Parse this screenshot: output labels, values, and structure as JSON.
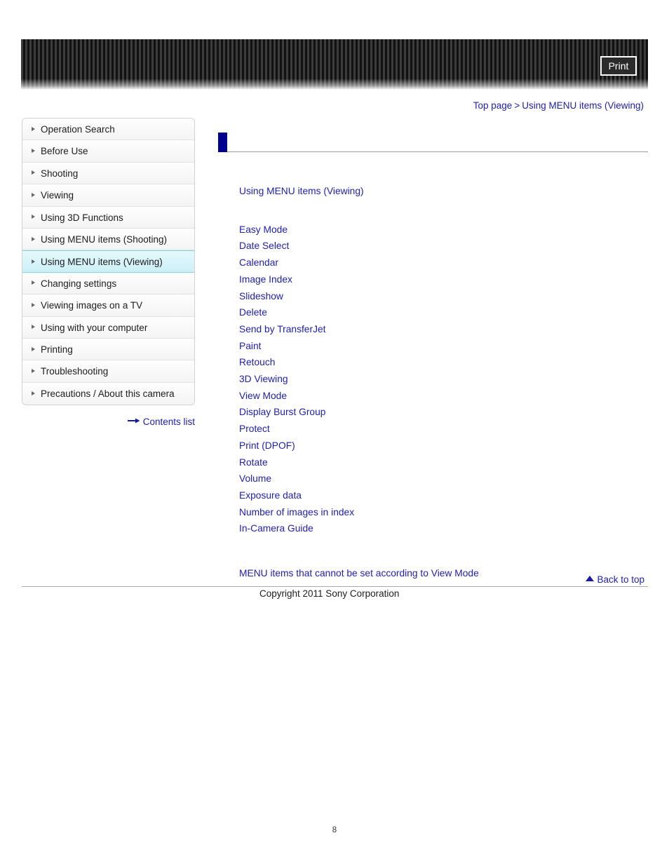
{
  "header": {
    "print_label": "Print"
  },
  "breadcrumb": {
    "top": "Top page",
    "separator": ">",
    "current": "Using MENU items (Viewing)"
  },
  "sidebar": {
    "items": [
      {
        "label": "Operation Search",
        "active": false
      },
      {
        "label": "Before Use",
        "active": false
      },
      {
        "label": "Shooting",
        "active": false
      },
      {
        "label": "Viewing",
        "active": false
      },
      {
        "label": "Using 3D Functions",
        "active": false
      },
      {
        "label": "Using MENU items (Shooting)",
        "active": false
      },
      {
        "label": "Using MENU items (Viewing)",
        "active": true
      },
      {
        "label": "Changing settings",
        "active": false
      },
      {
        "label": "Viewing images on a TV",
        "active": false
      },
      {
        "label": "Using with your computer",
        "active": false
      },
      {
        "label": "Printing",
        "active": false
      },
      {
        "label": "Troubleshooting",
        "active": false
      },
      {
        "label": "Precautions / About this camera",
        "active": false
      }
    ],
    "contents_list_label": "Contents list"
  },
  "main": {
    "title": "",
    "section_link": "Using MENU items (Viewing)",
    "links": [
      "Easy Mode",
      "Date Select",
      "Calendar",
      "Image Index",
      "Slideshow",
      "Delete",
      "Send by TransferJet",
      "Paint",
      "Retouch",
      "3D Viewing",
      "View Mode",
      "Display Burst Group",
      "Protect",
      "Print (DPOF)",
      "Rotate",
      "Volume",
      "Exposure data",
      "Number of images in index",
      "In-Camera Guide"
    ],
    "note_link": "MENU items that cannot be set according to View Mode"
  },
  "footer": {
    "back_to_top_label": "Back to top",
    "copyright": "Copyright 2011 Sony Corporation",
    "page_number": "8"
  },
  "colors": {
    "link": "#2020b0",
    "accent_bar": "#00008f",
    "active_sidebar": "#cdf0f8"
  }
}
